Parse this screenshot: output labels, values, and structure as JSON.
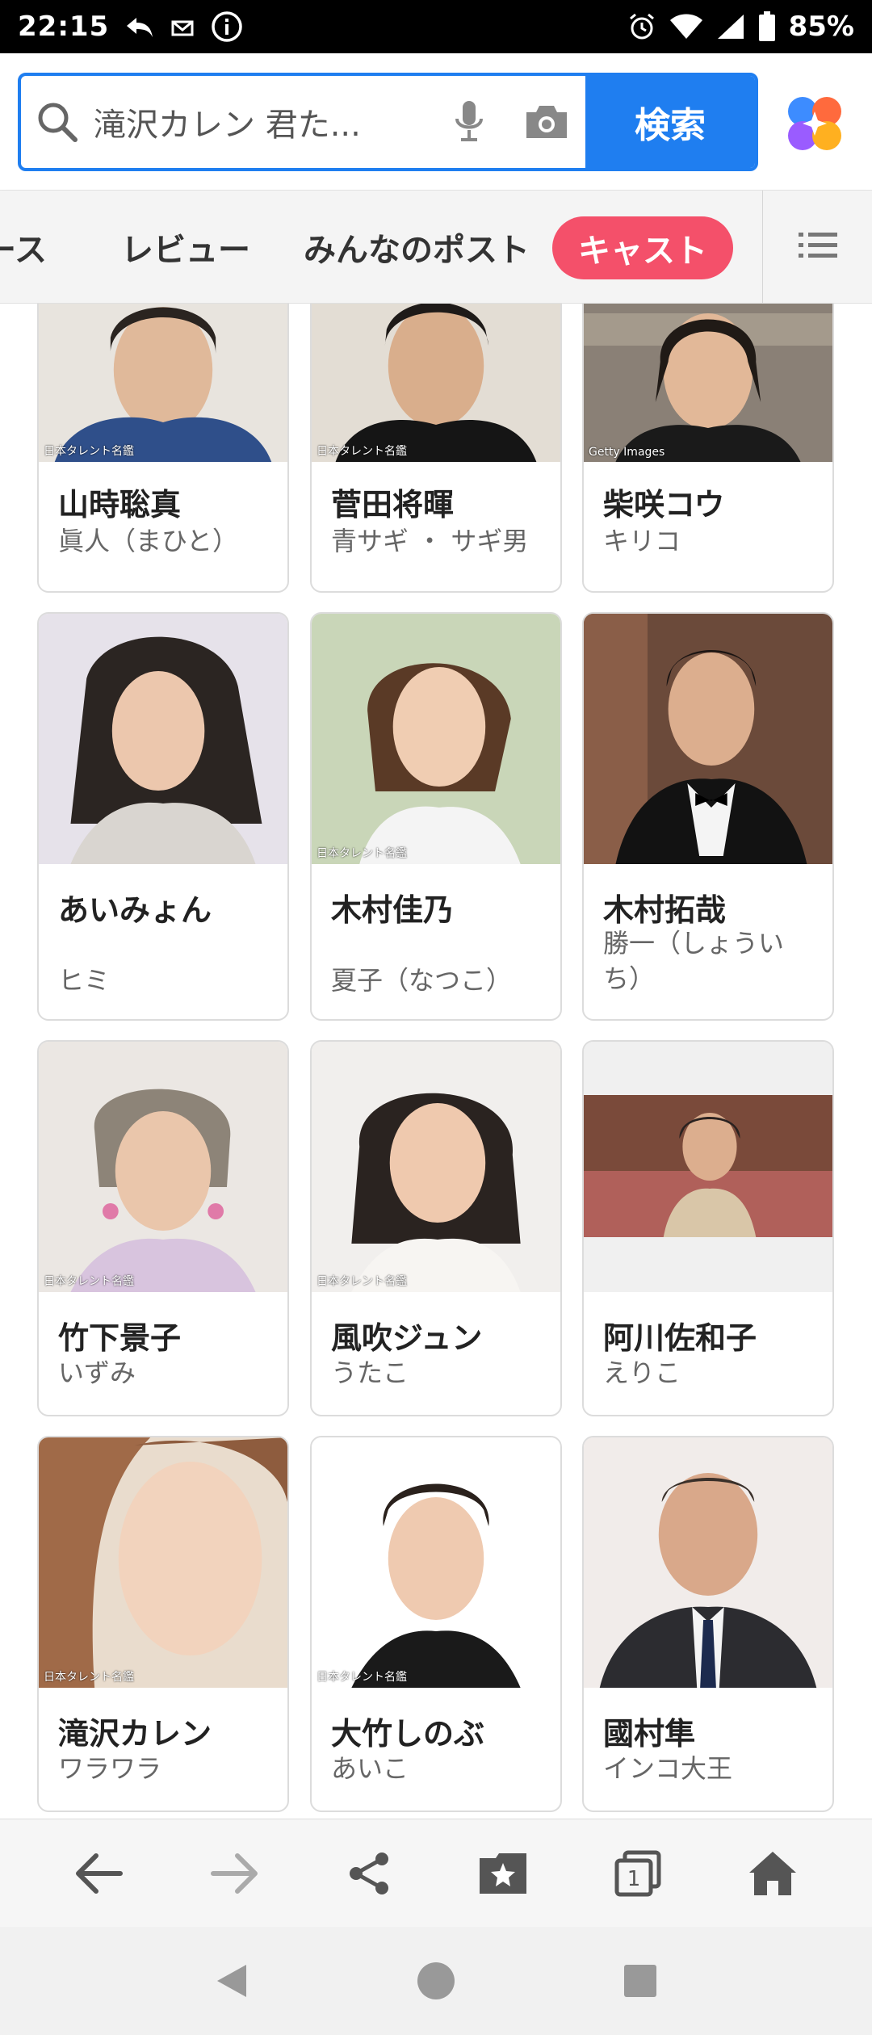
{
  "status_bar": {
    "time": "22:15",
    "battery": "85%"
  },
  "search": {
    "query": "滝沢カレン 君た...",
    "button_label": "検索"
  },
  "tabs": [
    {
      "label": "ース"
    },
    {
      "label": "レビュー"
    },
    {
      "label": "みんなのポスト"
    },
    {
      "label": "キャスト",
      "active": true
    }
  ],
  "cast": [
    {
      "name": "山時聡真",
      "role": "眞人（まひと）",
      "credit": "日本タレント名鑑"
    },
    {
      "name": "菅田将暉",
      "role": "青サギ ・ サギ男",
      "credit": "日本タレント名鑑"
    },
    {
      "name": "柴咲コウ",
      "role": "キリコ",
      "credit": "Getty Images"
    },
    {
      "name": "あいみょん",
      "role": "ヒミ",
      "credit": ""
    },
    {
      "name": "木村佳乃",
      "role": "夏子（なつこ）",
      "credit": "日本タレント名鑑"
    },
    {
      "name": "木村拓哉",
      "role": "勝一（しょういち）",
      "credit": ""
    },
    {
      "name": "竹下景子",
      "role": "いずみ",
      "credit": "日本タレント名鑑"
    },
    {
      "name": "風吹ジュン",
      "role": "うたこ",
      "credit": "日本タレント名鑑"
    },
    {
      "name": "阿川佐和子",
      "role": "えりこ",
      "credit": ""
    },
    {
      "name": "滝沢カレン",
      "role": "ワラワラ",
      "credit": "日本タレント名鑑"
    },
    {
      "name": "大竹しのぶ",
      "role": "あいこ",
      "credit": "日本タレント名鑑"
    },
    {
      "name": "國村隼",
      "role": "インコ大王",
      "credit": ""
    }
  ],
  "browser_bar": {
    "tab_count": "1"
  },
  "colors": {
    "accent_blue": "#1f7ef0",
    "active_tab_pink": "#f4506a"
  }
}
